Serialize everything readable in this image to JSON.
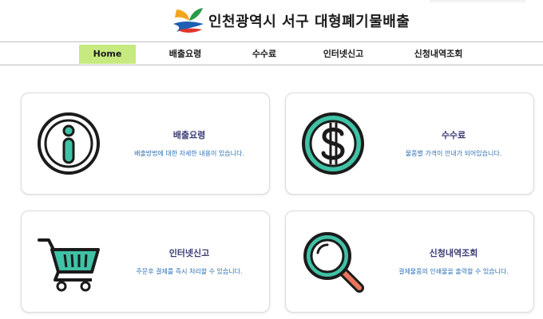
{
  "header": {
    "title": "인천광역시 서구  대형폐기물배출"
  },
  "nav": {
    "items": [
      {
        "label": "Home",
        "active": true
      },
      {
        "label": "배출요령",
        "active": false
      },
      {
        "label": "수수료",
        "active": false
      },
      {
        "label": "인터넷신고",
        "active": false
      },
      {
        "label": "신청내역조회",
        "active": false
      }
    ]
  },
  "cards": [
    {
      "title": "배출요령",
      "desc": "배출방법에 대한 자세한 내용이 있습니다.",
      "icon": "info-icon"
    },
    {
      "title": "수수료",
      "desc": "물품별 가격이 안내가 되어있습니다.",
      "icon": "dollar-coin-icon"
    },
    {
      "title": "인터넷신고",
      "desc": "주문후 결제를 즉시 처리할 수 있습니다.",
      "icon": "shopping-cart-icon"
    },
    {
      "title": "신청내역조회",
      "desc": "결제물품의 인쇄물을 출력할 수 있습니다.",
      "icon": "magnifier-icon"
    }
  ],
  "colors": {
    "accent": "#c6ea7f",
    "icon_teal": "#3fc2a5",
    "icon_outline": "#1b1b1b",
    "title_text": "#3b3b75",
    "desc_text": "#2c6fb5",
    "magnifier_handle": "#e8765a"
  }
}
